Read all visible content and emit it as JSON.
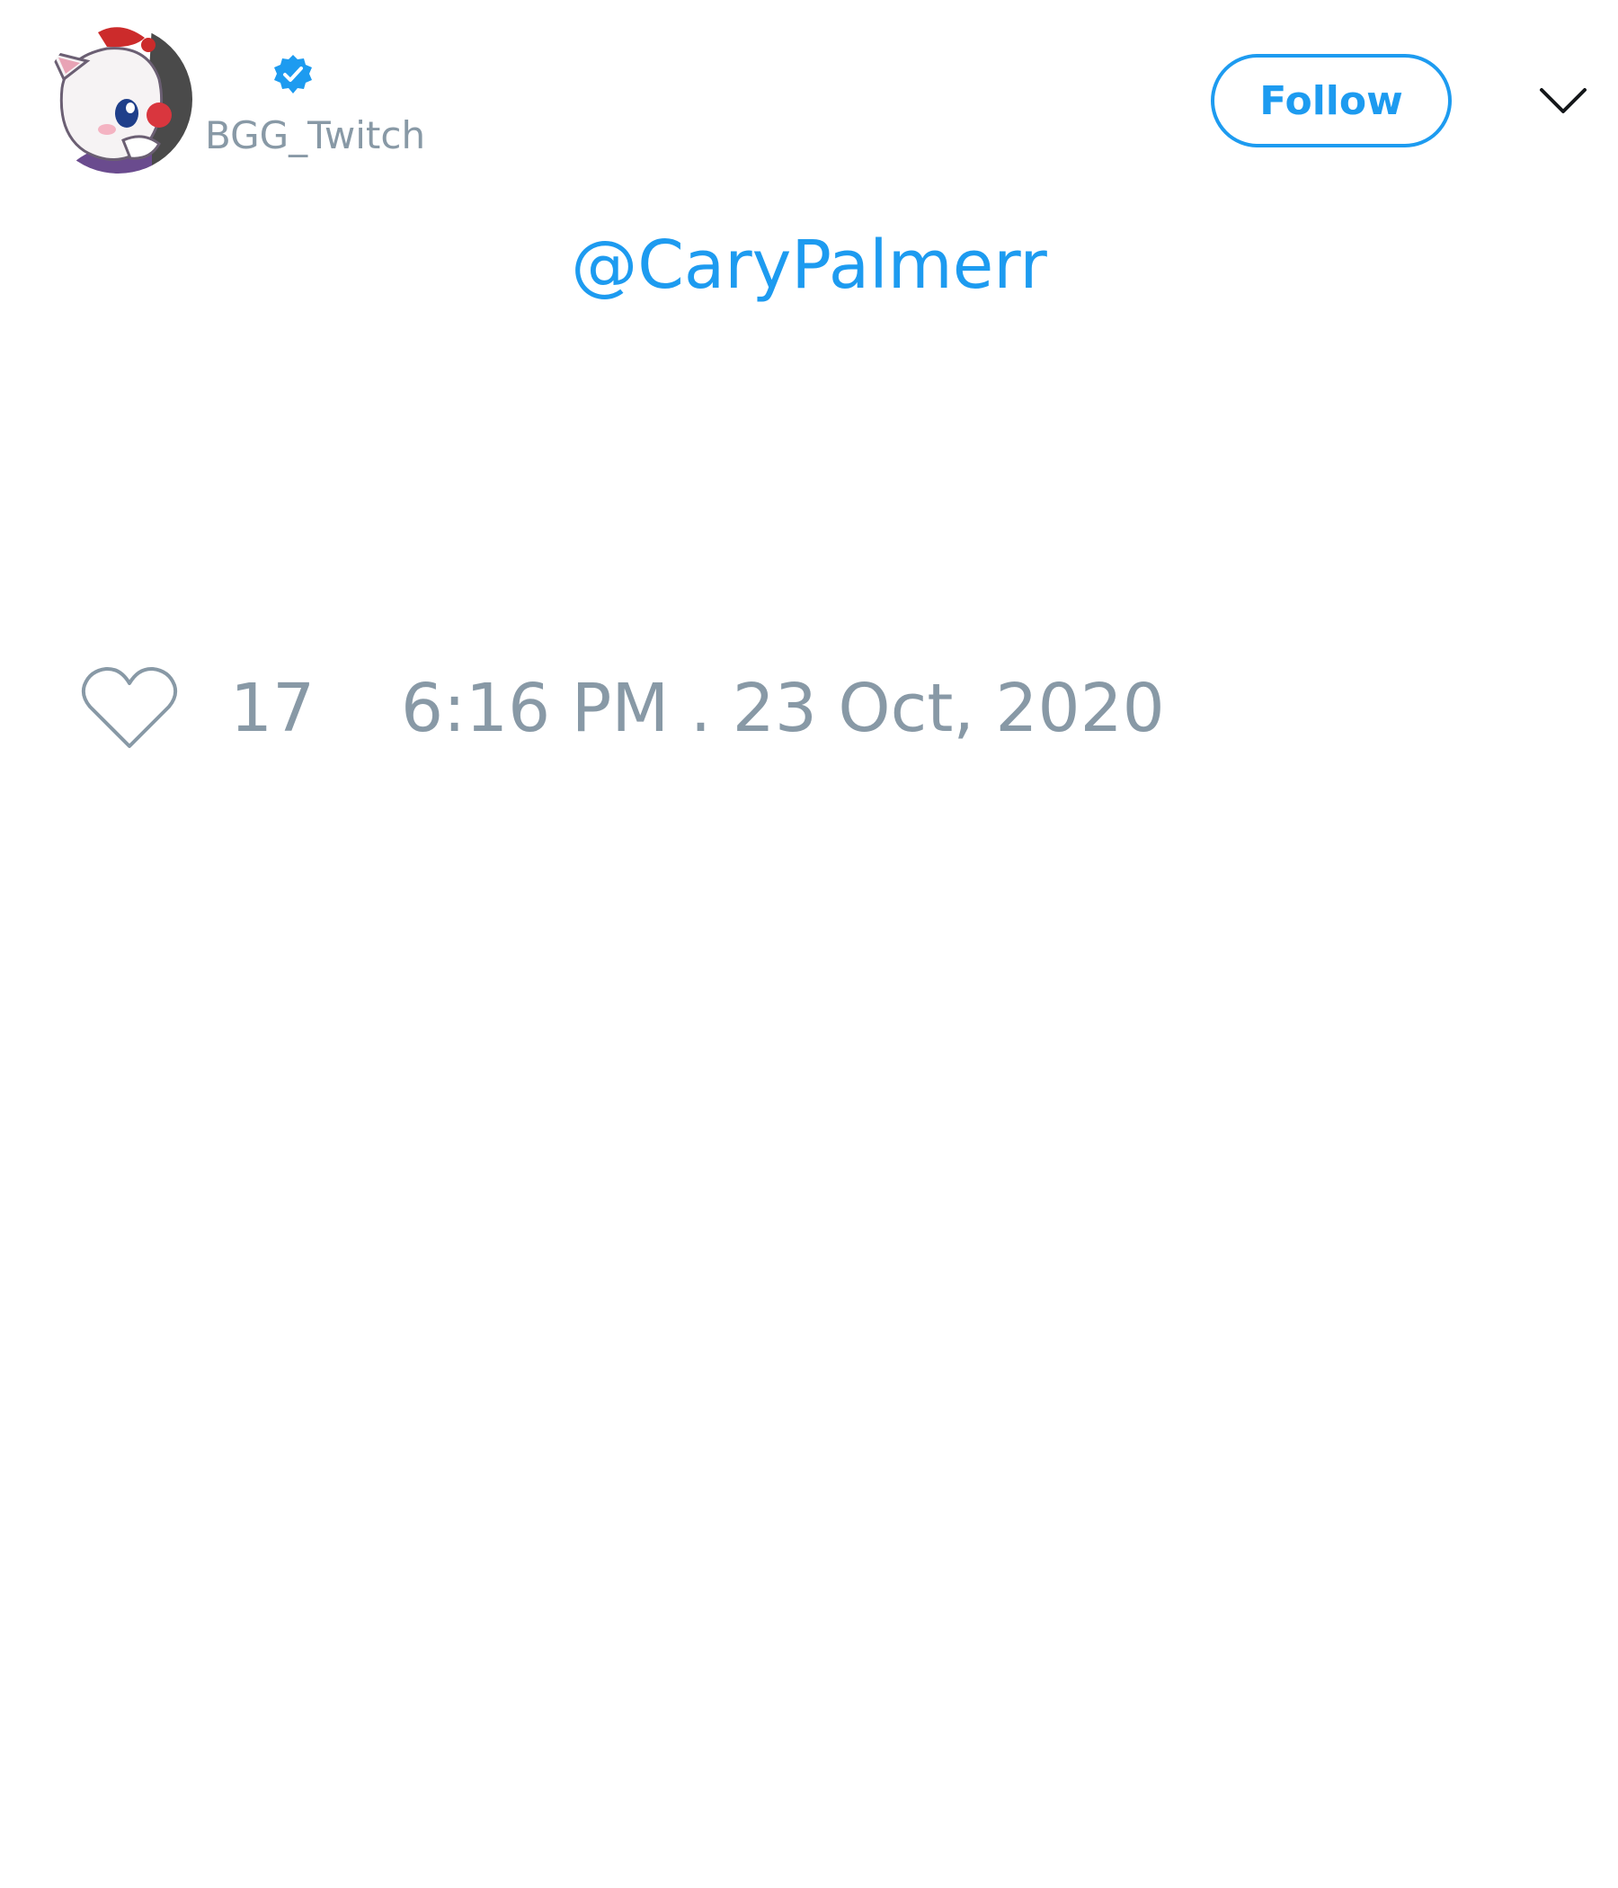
{
  "tweet": {
    "author": {
      "handle": "BGG_Twitch",
      "verified": true,
      "avatar_icon": "red-panda-mascot-avatar"
    },
    "follow_label": "Follow",
    "menu_icon": "chevron-down-icon",
    "mention": "@CaryPalmerr",
    "likes": "17",
    "timestamp": "6:16 PM . 23 Oct, 2020"
  },
  "colors": {
    "accent": "#1d9bf0",
    "muted_text": "#8899a6",
    "background": "#ffffff"
  }
}
